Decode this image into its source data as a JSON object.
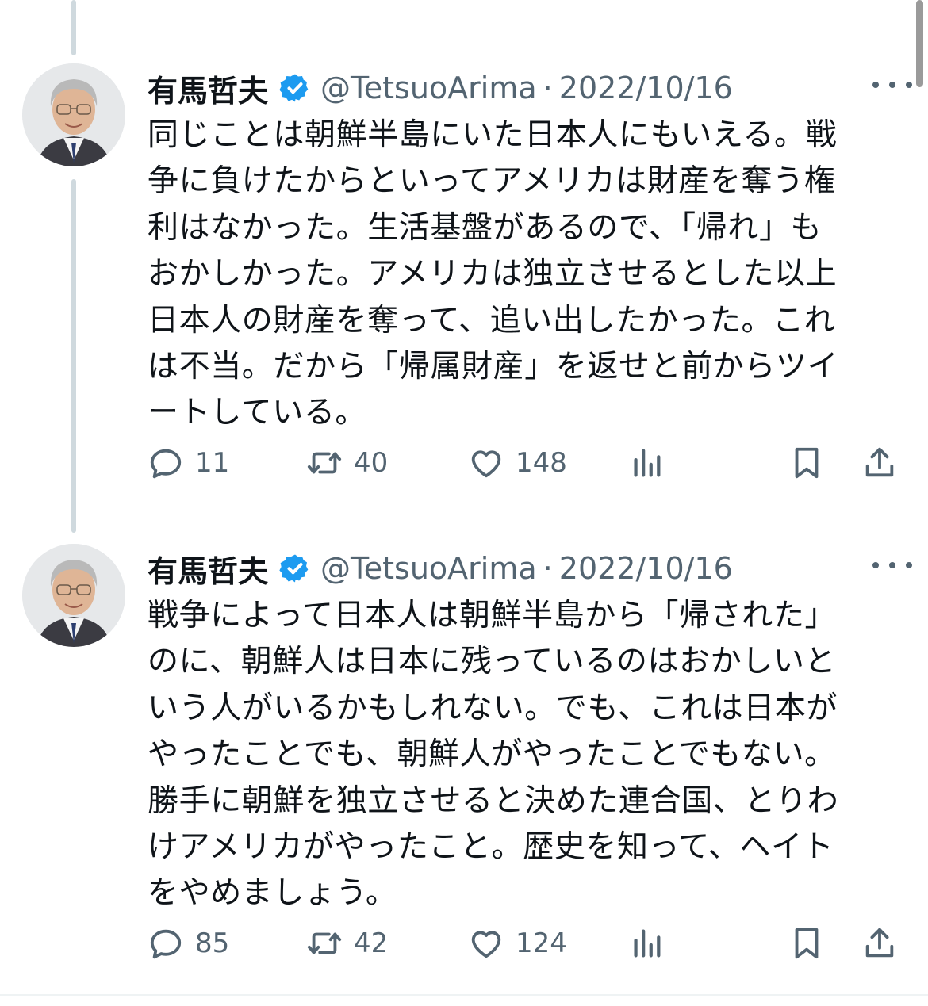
{
  "tweets": [
    {
      "author_name": "有馬哲夫",
      "handle": "@TetsuoArima",
      "separator": "·",
      "date": "2022/10/16",
      "text": "同じことは朝鮮半島にいた日本人にもいえる。戦\n争に負けたからといってアメリカは財産を奪う権\n利はなかった。生活基盤があるので、「帰れ」も\nおかしかった。アメリカは独立させるとした以上\n日本人の財産を奪って、追い出したかった。これ\nは不当。だから「帰属財産」を返せと前からツイ\nートしている。",
      "replies": "11",
      "retweets": "40",
      "likes": "148"
    },
    {
      "author_name": "有馬哲夫",
      "handle": "@TetsuoArima",
      "separator": "·",
      "date": "2022/10/16",
      "text": "戦争によって日本人は朝鮮半島から「帰された」\nのに、朝鮮人は日本に残っているのはおかしいと\nいう人がいるかもしれない。でも、これは日本が\nやったことでも、朝鮮人がやったことでもない。\n勝手に朝鮮を独立させると決めた連合国、とりわ\nけアメリカがやったこと。歴史を知って、ヘイト\nをやめましょう。",
      "replies": "85",
      "retweets": "42",
      "likes": "124"
    }
  ],
  "icons": {
    "verified": "verified-badge-icon",
    "more": "more-icon",
    "reply": "reply-icon",
    "retweet": "retweet-icon",
    "like": "heart-icon",
    "views": "analytics-icon",
    "bookmark": "bookmark-icon",
    "share": "share-icon"
  },
  "colors": {
    "verified": "#1d9bf0",
    "secondary_text": "#536471",
    "thread_line": "#cfd9de"
  }
}
